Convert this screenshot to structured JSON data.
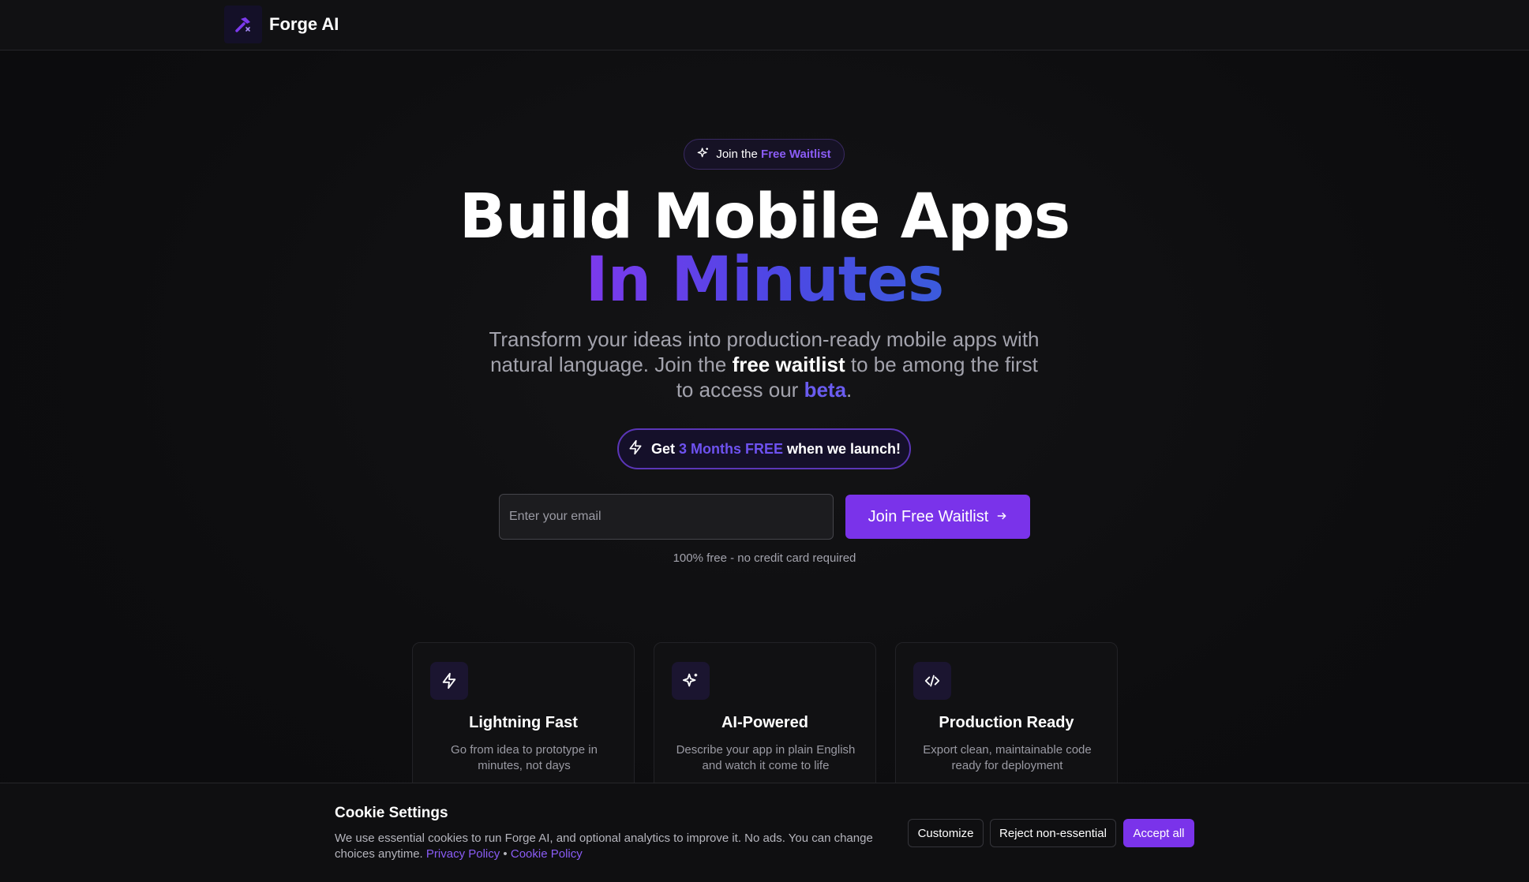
{
  "nav": {
    "brand_name": "Forge AI",
    "logo_icon": "hammer-icon"
  },
  "hero": {
    "badge": {
      "prefix": "Join the",
      "accent": "Free Waitlist",
      "icon": "sparkles-icon"
    },
    "headline_line1": "Build Mobile Apps",
    "headline_line2": "In Minutes",
    "subtitle": {
      "part1": "Transform your ideas into production-ready mobile apps with natural language. Join the",
      "bold": "free waitlist",
      "part2": "to be among the first to access our",
      "beta": "beta",
      "end": "."
    },
    "promo": {
      "prefix": "Get",
      "accent": "3 Months FREE",
      "suffix": "when we launch!",
      "icon": "lightning-icon"
    },
    "email_placeholder": "Enter your email",
    "email_value": "",
    "join_button": "Join Free Waitlist",
    "note": "100% free - no credit card required"
  },
  "features": [
    {
      "icon": "lightning-icon",
      "title": "Lightning Fast",
      "desc": "Go from idea to prototype in minutes, not days"
    },
    {
      "icon": "sparkles-icon",
      "title": "AI-Powered",
      "desc": "Describe your app in plain English and watch it come to life"
    },
    {
      "icon": "code-icon",
      "title": "Production Ready",
      "desc": "Export clean, maintainable code ready for deployment"
    }
  ],
  "cookie": {
    "title": "Cookie Settings",
    "text": "We use essential cookies to run Forge AI, and optional analytics to improve it. No ads. You can change choices anytime.",
    "privacy_link": "Privacy Policy",
    "separator": "•",
    "cookie_link": "Cookie Policy",
    "customize": "Customize",
    "reject": "Reject non-essential",
    "accept": "Accept all"
  },
  "colors": {
    "accent": "#7a33ea",
    "accent_text": "#8a5cf5",
    "background": "#0d0d0f"
  }
}
